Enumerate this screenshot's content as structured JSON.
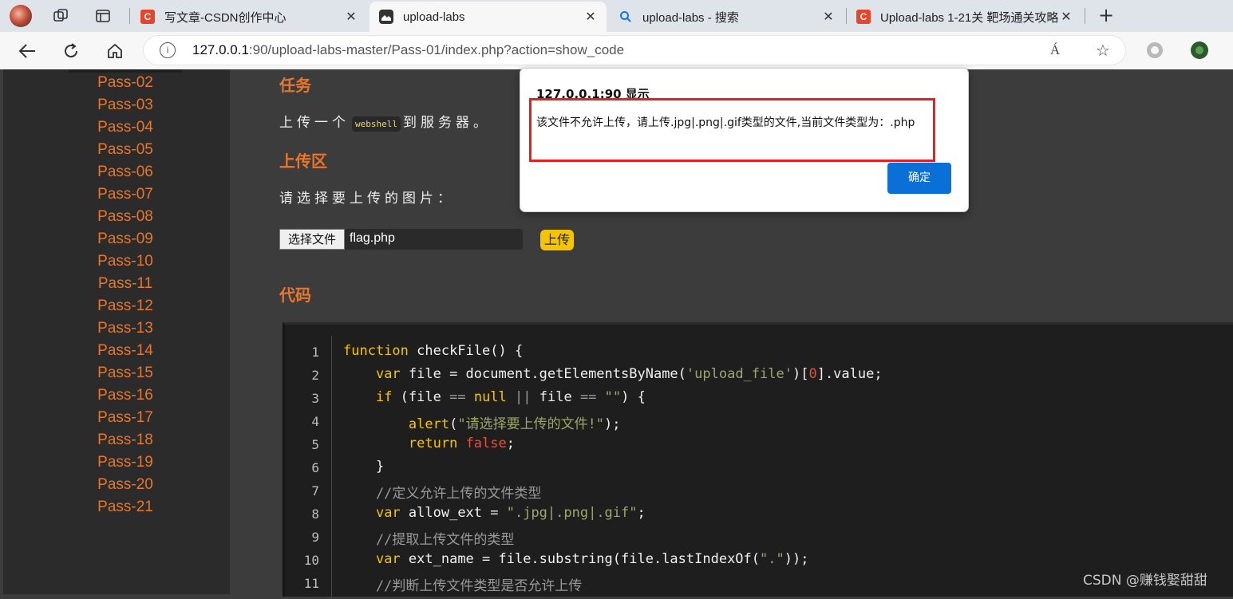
{
  "browser": {
    "tabs": [
      {
        "title": "写文章-CSDN创作中心",
        "icon": "csdn-logo-icon",
        "active": false
      },
      {
        "title": "upload-labs",
        "icon": "page-icon",
        "active": true
      },
      {
        "title": "upload-labs - 搜索",
        "icon": "search-icon",
        "active": false
      },
      {
        "title": "Upload-labs 1-21关 靶场通关攻略",
        "icon": "csdn-logo-icon",
        "active": false
      }
    ],
    "url_host": "127.0.0.1",
    "url_rest": ":90/upload-labs-master/Pass-01/index.php?action=show_code",
    "icons": {
      "info": "i",
      "read_aloud": "Á",
      "favorite": "☆",
      "back": "←",
      "reload": "⟳",
      "home": "⌂",
      "new_tab": "+",
      "close": "✕"
    }
  },
  "sidebar": {
    "items": [
      "Pass-02",
      "Pass-03",
      "Pass-04",
      "Pass-05",
      "Pass-06",
      "Pass-07",
      "Pass-08",
      "Pass-09",
      "Pass-10",
      "Pass-11",
      "Pass-12",
      "Pass-13",
      "Pass-14",
      "Pass-15",
      "Pass-16",
      "Pass-17",
      "Pass-18",
      "Pass-19",
      "Pass-20",
      "Pass-21"
    ]
  },
  "main": {
    "task_heading": "任务",
    "task_text_before": "上传一个",
    "task_code": "webshell",
    "task_text_after": "到服务器。",
    "upload_heading": "上传区",
    "upload_prompt": "请选择要上传的图片：",
    "file_button": "选择文件",
    "file_name": "flag.php",
    "upload_button": "上传",
    "code_heading": "代码"
  },
  "code": {
    "line_numbers": [
      "1",
      "2",
      "3",
      "4",
      "5",
      "6",
      "7",
      "8",
      "9",
      "10",
      "11"
    ]
  },
  "dialog": {
    "title": "127.0.0.1:90 显示",
    "message": "该文件不允许上传，请上传.jpg|.png|.gif类型的文件,当前文件类型为：.php",
    "ok_button": "确定"
  },
  "watermark": "CSDN @赚钱娶甜甜",
  "colors": {
    "accent": "#e8762c",
    "keyword": "#f5c400",
    "dialog_button": "#0a6fd6",
    "highlight_box": "#e5201f"
  }
}
